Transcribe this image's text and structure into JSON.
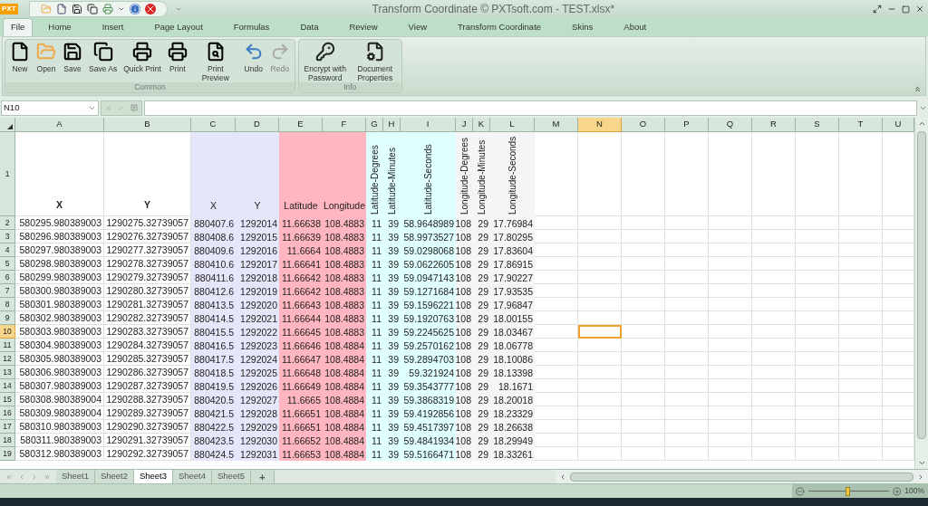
{
  "window": {
    "title": "Transform Coordinate © PXTsoft.com - TEST.xlsx*",
    "logo": "PXT"
  },
  "ribbon_tabs": [
    {
      "label": "File",
      "selected": true
    },
    {
      "label": "Home",
      "selected": false
    },
    {
      "label": "Insert",
      "selected": false
    },
    {
      "label": "Page Layout",
      "selected": false
    },
    {
      "label": "Formulas",
      "selected": false
    },
    {
      "label": "Data",
      "selected": false
    },
    {
      "label": "Review",
      "selected": false
    },
    {
      "label": "View",
      "selected": false
    },
    {
      "label": "Transform Coordinate",
      "selected": false
    },
    {
      "label": "Skins",
      "selected": false
    },
    {
      "label": "About",
      "selected": false
    }
  ],
  "ribbon_groups": [
    {
      "label": "Common",
      "buttons": [
        {
          "kind": "new",
          "label": "New",
          "disabled": false
        },
        {
          "kind": "open",
          "label": "Open",
          "disabled": false
        },
        {
          "kind": "save",
          "label": "Save",
          "disabled": false
        },
        {
          "kind": "saveas",
          "label": "Save As",
          "disabled": false
        },
        {
          "kind": "quickprint",
          "label": "Quick Print",
          "disabled": false
        },
        {
          "kind": "print",
          "label": "Print",
          "disabled": false
        },
        {
          "kind": "preview",
          "label": "Print Preview",
          "disabled": false
        },
        {
          "kind": "undo",
          "label": "Undo",
          "disabled": false
        },
        {
          "kind": "redo",
          "label": "Redo",
          "disabled": true
        }
      ]
    },
    {
      "label": "Info",
      "buttons": [
        {
          "kind": "encrypt",
          "label": "Encrypt with Password",
          "disabled": false
        },
        {
          "kind": "properties",
          "label": "Document Properties",
          "disabled": false
        }
      ]
    }
  ],
  "formula_bar": {
    "name_box": "N10"
  },
  "columns": [
    {
      "label": "A",
      "selected": false
    },
    {
      "label": "B",
      "selected": false
    },
    {
      "label": "C",
      "selected": false,
      "color": "#e6e6fa"
    },
    {
      "label": "D",
      "selected": false,
      "color": "#e6e6fa"
    },
    {
      "label": "E",
      "selected": false,
      "color": "#ffb6c1"
    },
    {
      "label": "F",
      "selected": false,
      "color": "#ffb6c1"
    },
    {
      "label": "G",
      "selected": false,
      "color": "#e0ffff"
    },
    {
      "label": "H",
      "selected": false,
      "color": "#e0ffff"
    },
    {
      "label": "I",
      "selected": false,
      "color": "#e0ffff"
    },
    {
      "label": "J",
      "selected": false,
      "color": "#f5f5f5"
    },
    {
      "label": "K",
      "selected": false,
      "color": "#f5f5f5"
    },
    {
      "label": "L",
      "selected": false,
      "color": "#f5f5f5"
    },
    {
      "label": "M",
      "selected": false
    },
    {
      "label": "N",
      "selected": true
    },
    {
      "label": "O",
      "selected": false
    },
    {
      "label": "P",
      "selected": false
    },
    {
      "label": "Q",
      "selected": false
    },
    {
      "label": "R",
      "selected": false
    },
    {
      "label": "S",
      "selected": false
    },
    {
      "label": "T",
      "selected": false
    },
    {
      "label": "U",
      "selected": false
    }
  ],
  "header_row": {
    "label": "1",
    "cells": [
      {
        "text": "X",
        "bold": true,
        "vertical": false
      },
      {
        "text": "Y",
        "bold": true,
        "vertical": false
      },
      {
        "text": "X",
        "bold": false,
        "vertical": false
      },
      {
        "text": "Y",
        "bold": false,
        "vertical": false
      },
      {
        "text": "Latitude",
        "bold": false,
        "vertical": false
      },
      {
        "text": "Longitude",
        "bold": false,
        "vertical": false
      },
      {
        "text": "Latitude-Degrees",
        "bold": false,
        "vertical": true
      },
      {
        "text": "Latitude-Minutes",
        "bold": false,
        "vertical": true
      },
      {
        "text": "Latitude-Seconds",
        "bold": false,
        "vertical": true
      },
      {
        "text": "Longitude-Degrees",
        "bold": false,
        "vertical": true
      },
      {
        "text": "Longitude-Minutes",
        "bold": false,
        "vertical": true
      },
      {
        "text": "Longitude-Seconds",
        "bold": false,
        "vertical": true
      }
    ]
  },
  "rows": [
    {
      "label": "2",
      "selected": false,
      "cells": [
        "580295.980389003",
        "1290275.32739057",
        "880407.6",
        "1292014",
        "11.66638",
        "108.4883",
        "11",
        "39",
        "58.9648989",
        "108",
        "29",
        "17.76984"
      ]
    },
    {
      "label": "3",
      "selected": false,
      "cells": [
        "580296.980389003",
        "1290276.32739057",
        "880408.6",
        "1292015",
        "11.66639",
        "108.4883",
        "11",
        "39",
        "58.9973527",
        "108",
        "29",
        "17.80295"
      ]
    },
    {
      "label": "4",
      "selected": false,
      "cells": [
        "580297.980389003",
        "1290277.32739057",
        "880409.6",
        "1292016",
        "11.6664",
        "108.4883",
        "11",
        "39",
        "59.0298068",
        "108",
        "29",
        "17.83604"
      ]
    },
    {
      "label": "5",
      "selected": false,
      "cells": [
        "580298.980389003",
        "1290278.32739057",
        "880410.6",
        "1292017",
        "11.66641",
        "108.4883",
        "11",
        "39",
        "59.0622605",
        "108",
        "29",
        "17.86915"
      ]
    },
    {
      "label": "6",
      "selected": false,
      "cells": [
        "580299.980389003",
        "1290279.32739057",
        "880411.6",
        "1292018",
        "11.66642",
        "108.4883",
        "11",
        "39",
        "59.0947143",
        "108",
        "29",
        "17.90227"
      ]
    },
    {
      "label": "7",
      "selected": false,
      "cells": [
        "580300.980389003",
        "1290280.32739057",
        "880412.6",
        "1292019",
        "11.66642",
        "108.4883",
        "11",
        "39",
        "59.1271684",
        "108",
        "29",
        "17.93535"
      ]
    },
    {
      "label": "8",
      "selected": false,
      "cells": [
        "580301.980389003",
        "1290281.32739057",
        "880413.5",
        "1292020",
        "11.66643",
        "108.4883",
        "11",
        "39",
        "59.1596221",
        "108",
        "29",
        "17.96847"
      ]
    },
    {
      "label": "9",
      "selected": false,
      "cells": [
        "580302.980389003",
        "1290282.32739057",
        "880414.5",
        "1292021",
        "11.66644",
        "108.4883",
        "11",
        "39",
        "59.1920763",
        "108",
        "29",
        "18.00155"
      ]
    },
    {
      "label": "10",
      "selected": true,
      "cells": [
        "580303.980389003",
        "1290283.32739057",
        "880415.5",
        "1292022",
        "11.66645",
        "108.4883",
        "11",
        "39",
        "59.2245625",
        "108",
        "29",
        "18.03467"
      ]
    },
    {
      "label": "11",
      "selected": false,
      "cells": [
        "580304.980389003",
        "1290284.32739057",
        "880416.5",
        "1292023",
        "11.66646",
        "108.4884",
        "11",
        "39",
        "59.2570162",
        "108",
        "29",
        "18.06778"
      ]
    },
    {
      "label": "12",
      "selected": false,
      "cells": [
        "580305.980389003",
        "1290285.32739057",
        "880417.5",
        "1292024",
        "11.66647",
        "108.4884",
        "11",
        "39",
        "59.2894703",
        "108",
        "29",
        "18.10086"
      ]
    },
    {
      "label": "13",
      "selected": false,
      "cells": [
        "580306.980389003",
        "1290286.32739057",
        "880418.5",
        "1292025",
        "11.66648",
        "108.4884",
        "11",
        "39",
        "59.321924",
        "108",
        "29",
        "18.13398"
      ]
    },
    {
      "label": "14",
      "selected": false,
      "cells": [
        "580307.980389003",
        "1290287.32739057",
        "880419.5",
        "1292026",
        "11.66649",
        "108.4884",
        "11",
        "39",
        "59.3543777",
        "108",
        "29",
        "18.1671"
      ]
    },
    {
      "label": "15",
      "selected": false,
      "cells": [
        "580308.980389004",
        "1290288.32739057",
        "880420.5",
        "1292027",
        "11.6665",
        "108.4884",
        "11",
        "39",
        "59.3868319",
        "108",
        "29",
        "18.20018"
      ]
    },
    {
      "label": "16",
      "selected": false,
      "cells": [
        "580309.980389004",
        "1290289.32739057",
        "880421.5",
        "1292028",
        "11.66651",
        "108.4884",
        "11",
        "39",
        "59.4192856",
        "108",
        "29",
        "18.23329"
      ]
    },
    {
      "label": "17",
      "selected": false,
      "cells": [
        "580310.980389003",
        "1290290.32739057",
        "880422.5",
        "1292029",
        "11.66651",
        "108.4884",
        "11",
        "39",
        "59.4517397",
        "108",
        "29",
        "18.26638"
      ]
    },
    {
      "label": "18",
      "selected": false,
      "cells": [
        "580311.980389003",
        "1290291.32739057",
        "880423.5",
        "1292030",
        "11.66652",
        "108.4884",
        "11",
        "39",
        "59.4841934",
        "108",
        "29",
        "18.29949"
      ]
    },
    {
      "label": "19",
      "selected": false,
      "cells": [
        "580312.980389003",
        "1290292.32739057",
        "880424.5",
        "1292031",
        "11.66653",
        "108.4884",
        "11",
        "39",
        "59.5166471",
        "108",
        "29",
        "18.33261"
      ]
    }
  ],
  "sheet_tabs": [
    {
      "label": "Sheet1",
      "selected": false
    },
    {
      "label": "Sheet2",
      "selected": false
    },
    {
      "label": "Sheet3",
      "selected": true
    },
    {
      "label": "Sheet4",
      "selected": false
    },
    {
      "label": "Sheet5",
      "selected": false
    }
  ],
  "add_sheet": "+",
  "zoom": {
    "level": 0.5,
    "reading": "100%"
  }
}
